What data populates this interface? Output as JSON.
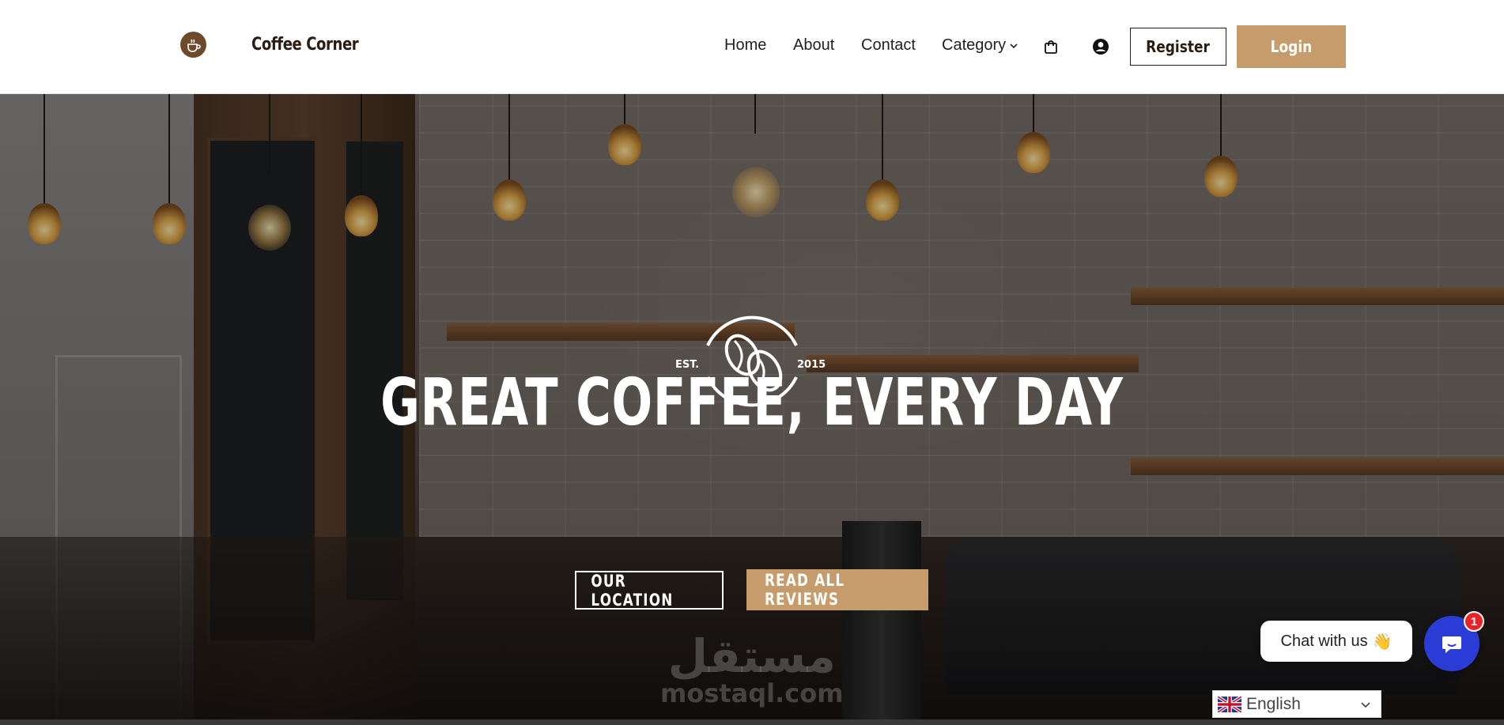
{
  "header": {
    "brand": "Coffee Corner",
    "nav": [
      {
        "label": "Home"
      },
      {
        "label": "About"
      },
      {
        "label": "Contact"
      },
      {
        "label": "Category"
      }
    ],
    "register_label": "Register",
    "login_label": "Login"
  },
  "hero": {
    "emblem_left": "EST.",
    "emblem_right": "2015",
    "title": "GREAT COFFEE, EVERY DAY",
    "location_button": "OUR LOCATION",
    "reviews_button": "READ ALL REVIEWS"
  },
  "watermark": {
    "arabic": "مستقل",
    "latin": "mostaql.com"
  },
  "chat": {
    "bubble_text": "Chat with us",
    "bubble_emoji": "👋",
    "badge_count": "1"
  },
  "language": {
    "selected": "English"
  },
  "colors": {
    "accent": "#c69c6d",
    "brand_dark": "#2a1c10",
    "chat_blue": "#2a3bd6",
    "badge_red": "#e8232a"
  }
}
